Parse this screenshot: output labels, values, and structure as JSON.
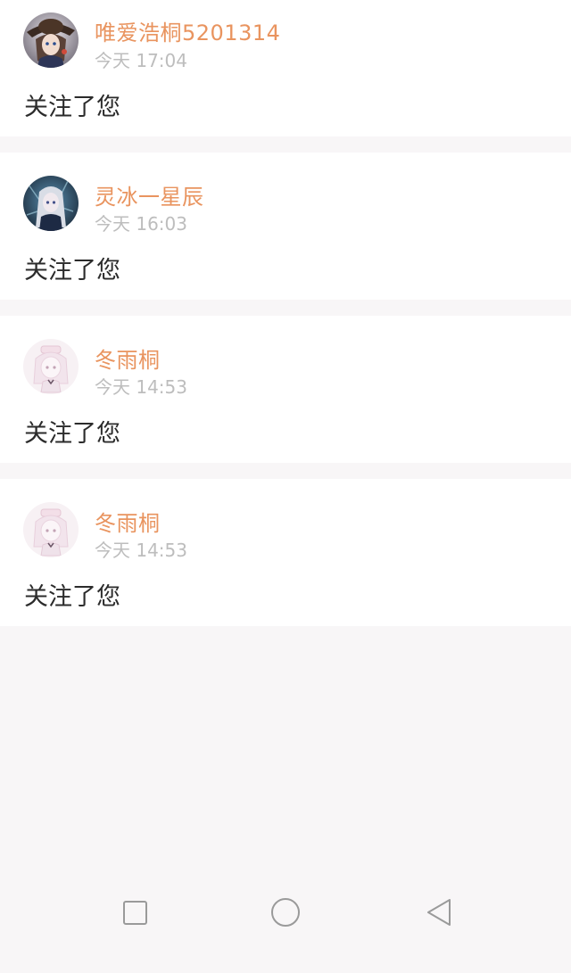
{
  "colors": {
    "name": "#e9945f",
    "time": "#bdbdbd",
    "message": "#2b2b2b",
    "background": "#f8f6f7",
    "card": "#ffffff"
  },
  "notifications": [
    {
      "user": "唯爱浩桐5201314",
      "time": "今天 17:04",
      "message": "关注了您",
      "avatar_icon": "anime-girl-with-hat-avatar"
    },
    {
      "user": "灵冰一星辰",
      "time": "今天 16:03",
      "message": "关注了您",
      "avatar_icon": "anime-silver-hair-avatar"
    },
    {
      "user": "冬雨桐",
      "time": "今天 14:53",
      "message": "关注了您",
      "avatar_icon": "pastel-chibi-girl-avatar"
    },
    {
      "user": "冬雨桐",
      "time": "今天 14:53",
      "message": "关注了您",
      "avatar_icon": "pastel-chibi-girl-avatar"
    }
  ],
  "navbar": {
    "items": [
      {
        "icon": "recent-apps-square-icon"
      },
      {
        "icon": "home-circle-icon"
      },
      {
        "icon": "back-triangle-icon"
      }
    ]
  }
}
